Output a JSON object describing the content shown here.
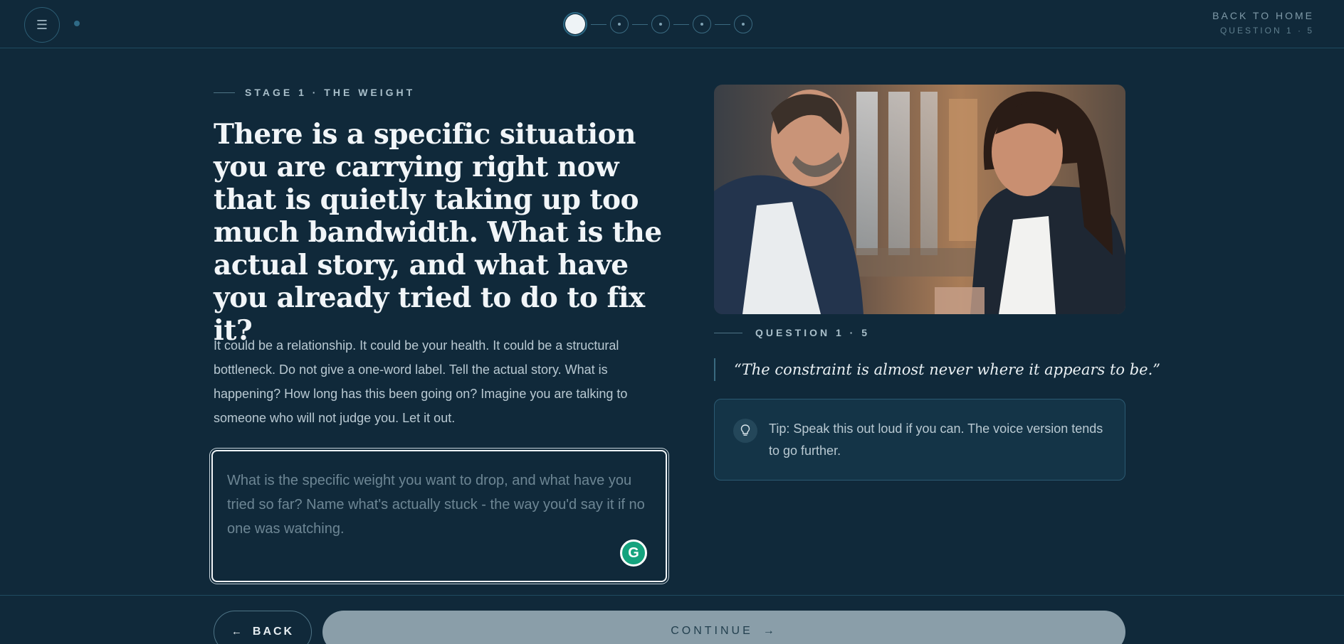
{
  "header": {
    "menu_icon": "☰",
    "back_home": "BACK TO HOME",
    "question_count": "QUESTION 1 · 5",
    "progress_steps": 5,
    "active_step": 1
  },
  "main": {
    "stage_label": "STAGE 1 · THE WEIGHT",
    "question": "There is a specific situation you are carrying right now that is quietly taking up too much bandwidth. What is the actual story, and what have you already tried to do to fix it?",
    "description": "It could be a relationship. It could be your health. It could be a structural bottleneck. Do not give a one-word label. Tell the actual story. What is happening? How long has this been going on? Imagine you are talking to someone who will not judge you. Let it out.",
    "answer": {
      "value": "",
      "placeholder": "What is the specific weight you want to drop, and what have you tried so far? Name what's actually stuck - the way you'd say it if no one was watching."
    },
    "grammarly_label": "G"
  },
  "side": {
    "question_label": "QUESTION 1 · 5",
    "quote": "“The constraint is almost never where it appears to be.”",
    "tip": "Tip: Speak this out loud if you can. The voice version tends to go further.",
    "tip_icon": "lightbulb-icon"
  },
  "footer": {
    "back_label": "BACK",
    "continue_label": "CONTINUE"
  },
  "colors": {
    "background": "#10293a",
    "accent": "#2d6a86",
    "continue_button": "#8a9ea9"
  }
}
